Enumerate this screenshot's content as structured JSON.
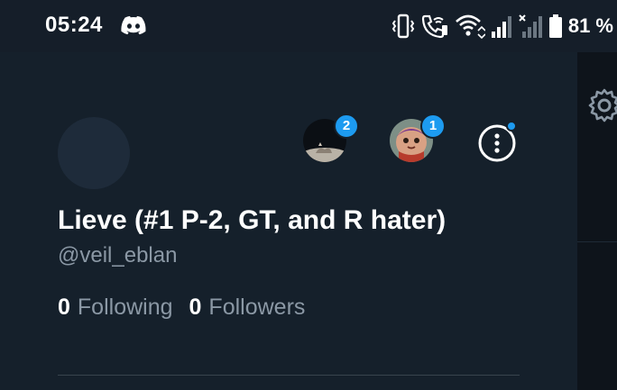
{
  "status_bar": {
    "time": "05:24",
    "battery_percent": "81 %",
    "icons": [
      "discord-icon",
      "vibrate-icon",
      "wifi-calling-icon",
      "wifi-icon",
      "signal-icon",
      "signal-no-service-icon",
      "battery-icon"
    ]
  },
  "profile": {
    "display_name": "Lieve (#1 P-2, GT, and R hater)",
    "handle": "@veil_eblan",
    "following_count": "0",
    "following_label": "Following",
    "followers_count": "0",
    "followers_label": "Followers"
  },
  "accounts": [
    {
      "name": "account-switch-1",
      "badge": "2"
    },
    {
      "name": "account-switch-2",
      "badge": "1"
    }
  ],
  "colors": {
    "background": "#15202b",
    "accent": "#1d9bf0",
    "secondary_text": "#8b98a5",
    "side_panel": "#0e141b"
  }
}
